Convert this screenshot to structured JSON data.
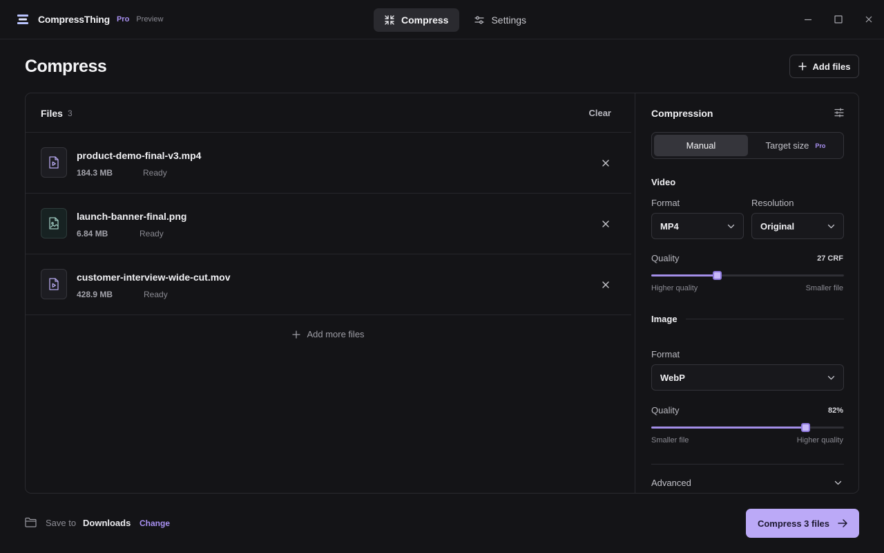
{
  "app": {
    "name": "CompressThing",
    "badge": "Pro",
    "channel": "Preview"
  },
  "nav": {
    "tabs": [
      {
        "label": "Compress",
        "icon": "compress-icon",
        "active": true
      },
      {
        "label": "Settings",
        "icon": "sliders-icon",
        "active": false
      }
    ]
  },
  "header": {
    "title": "Compress",
    "add_files_label": "Add files"
  },
  "files": {
    "title": "Files",
    "count": "3",
    "clear_label": "Clear",
    "items": [
      {
        "name": "product-demo-final-v3.mp4",
        "size": "184.3 MB",
        "status": "Ready",
        "kind": "video"
      },
      {
        "name": "launch-banner-final.png",
        "size": "6.84 MB",
        "status": "Ready",
        "kind": "image"
      },
      {
        "name": "customer-interview-wide-cut.mov",
        "size": "428.9 MB",
        "status": "Ready",
        "kind": "video"
      }
    ],
    "add_more_label": "Add more files"
  },
  "compression": {
    "title": "Compression",
    "modes": [
      {
        "label": "Manual",
        "active": true
      },
      {
        "label": "Target size",
        "tag": "Pro",
        "active": false
      }
    ],
    "video": {
      "title": "Video",
      "format_label": "Format",
      "format_value": "MP4",
      "resolution_label": "Resolution",
      "resolution_value": "Original",
      "quality_label": "Quality",
      "quality_value": "27 CRF",
      "quality_fraction": 0.34,
      "hint_left": "Higher quality",
      "hint_right": "Smaller file"
    },
    "image": {
      "title": "Image",
      "format_label": "Format",
      "format_value": "WebP",
      "quality_label": "Quality",
      "quality_value": "82%",
      "quality_fraction": 0.8,
      "hint_left": "Smaller file",
      "hint_right": "Higher quality"
    },
    "advanced_label": "Advanced"
  },
  "footer": {
    "save_prefix": "Save to",
    "save_destination": "Downloads",
    "change_label": "Change",
    "compress_label": "Compress 3 files"
  },
  "colors": {
    "accent": "#bba9f7",
    "accent_text": "#a991f2",
    "background": "#141417"
  }
}
